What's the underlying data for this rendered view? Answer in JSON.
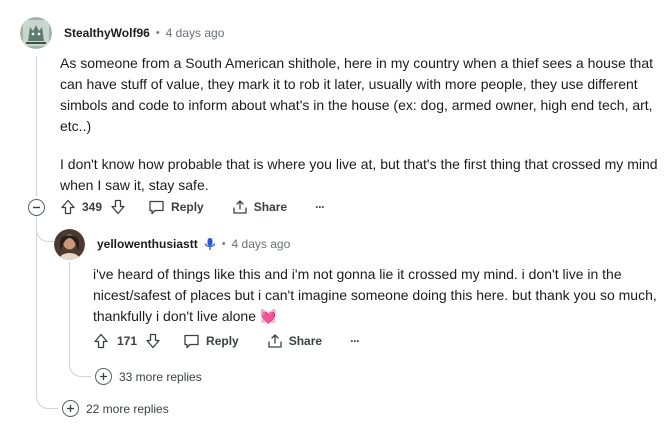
{
  "comment": {
    "username": "StealthyWolf96",
    "separator": "•",
    "timestamp": "4 days ago",
    "paragraphs": [
      "As someone from a South American shithole, here in my country when a thief sees a house that can have stuff of value, they mark it to rob it later, usually with more people, they use different simbols and code to inform about what's in the house (ex: dog, armed owner, high end tech, art, etc..)",
      "I don't know how probable that is where you live at, but that's the first thing that crossed my mind when I saw it, stay safe."
    ],
    "votes": "349",
    "reply_label": "Reply",
    "share_label": "Share",
    "more_label": "···",
    "more_replies": "22 more replies"
  },
  "reply": {
    "username": "yellowenthusiastt",
    "separator": "•",
    "timestamp": "4 days ago",
    "text": "i've heard of things like this and i'm not gonna lie it crossed my mind. i don't live in the nicest/safest of places but i can't imagine someone doing this here. but thank you so much, thankfully i don't live alone 💓",
    "votes": "171",
    "reply_label": "Reply",
    "share_label": "Share",
    "more_label": "···",
    "more_replies": "33 more replies"
  }
}
